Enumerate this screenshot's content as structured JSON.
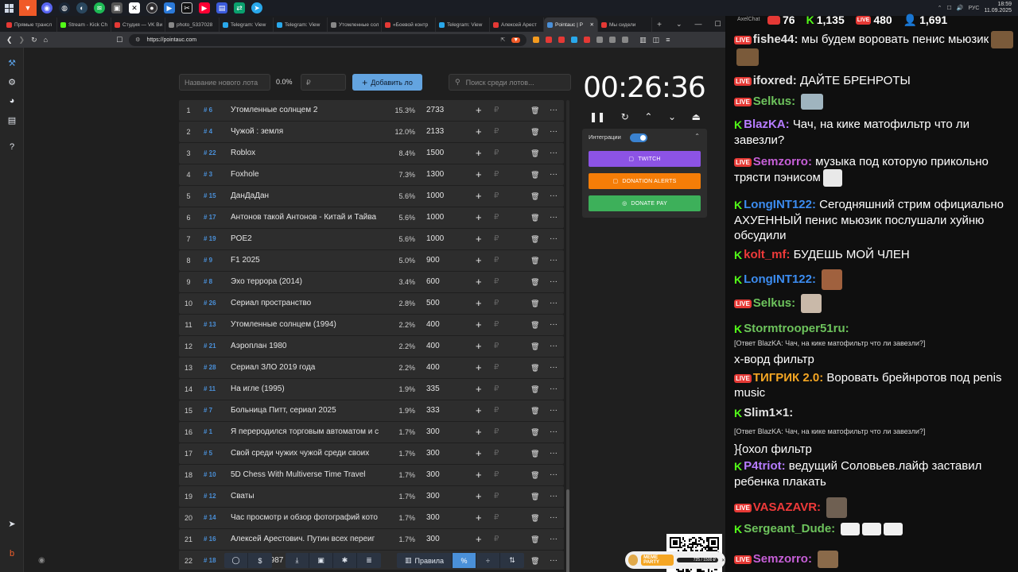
{
  "taskbar": {
    "tray_lang": "РУС",
    "time": "18:59",
    "date": "11.09.2025"
  },
  "browser": {
    "tabs": [
      {
        "label": "Прямые трансл",
        "color": "#e53935"
      },
      {
        "label": "Stream - Kick Ch",
        "color": "#53fc18"
      },
      {
        "label": "Студия — VK Ви",
        "color": "#e53935"
      },
      {
        "label": "photo_5337028",
        "color": "#888888"
      },
      {
        "label": "Telegram: View",
        "color": "#29a8eb"
      },
      {
        "label": "Telegram: View",
        "color": "#29a8eb"
      },
      {
        "label": "Утомленные сол",
        "color": "#888888"
      },
      {
        "label": "«Боевой контр",
        "color": "#e53935"
      },
      {
        "label": "Telegram: View",
        "color": "#29a8eb"
      },
      {
        "label": "Алексей Арест",
        "color": "#e53935"
      },
      {
        "label": "Pointauc | Р",
        "color": "#4a90d9",
        "active": true
      },
      {
        "label": "Мы сидели",
        "color": "#e53935"
      }
    ],
    "new_tab": "+",
    "url": "https://pointauc.com"
  },
  "controls": {
    "lot_name_placeholder": "Название нового лота",
    "percent": "0.0%",
    "price_placeholder": "₽",
    "add_button": "Добавить ло",
    "add_icon": "+",
    "search_placeholder": "Поиск среди лотов..."
  },
  "lots": [
    {
      "rank": "1",
      "id": "# 6",
      "name": "Утомленные солнцем 2",
      "pct": "15.3%",
      "amount": "2733"
    },
    {
      "rank": "2",
      "id": "# 4",
      "name": "Чужой : земля",
      "pct": "12.0%",
      "amount": "2133"
    },
    {
      "rank": "3",
      "id": "# 22",
      "name": "Roblox",
      "pct": "8.4%",
      "amount": "1500"
    },
    {
      "rank": "4",
      "id": "# 3",
      "name": "Foxhole",
      "pct": "7.3%",
      "amount": "1300"
    },
    {
      "rank": "5",
      "id": "# 15",
      "name": "ДанДаДан",
      "pct": "5.6%",
      "amount": "1000"
    },
    {
      "rank": "6",
      "id": "# 17",
      "name": "Антонов такой Антонов - Китай и Тайва",
      "pct": "5.6%",
      "amount": "1000"
    },
    {
      "rank": "7",
      "id": "# 19",
      "name": "POE2",
      "pct": "5.6%",
      "amount": "1000"
    },
    {
      "rank": "8",
      "id": "# 9",
      "name": "F1 2025",
      "pct": "5.0%",
      "amount": "900"
    },
    {
      "rank": "9",
      "id": "# 8",
      "name": "Эхо террора (2014)",
      "pct": "3.4%",
      "amount": "600"
    },
    {
      "rank": "10",
      "id": "# 26",
      "name": "Сериал пространство",
      "pct": "2.8%",
      "amount": "500"
    },
    {
      "rank": "11",
      "id": "# 13",
      "name": "Утомленные солнцем (1994)",
      "pct": "2.2%",
      "amount": "400"
    },
    {
      "rank": "12",
      "id": "# 21",
      "name": "Аэроплан 1980",
      "pct": "2.2%",
      "amount": "400"
    },
    {
      "rank": "13",
      "id": "# 28",
      "name": "Сериал ЗЛО 2019 года",
      "pct": "2.2%",
      "amount": "400"
    },
    {
      "rank": "14",
      "id": "# 11",
      "name": "На игле (1995)",
      "pct": "1.9%",
      "amount": "335"
    },
    {
      "rank": "15",
      "id": "# 7",
      "name": "Больница Питт, сериал 2025",
      "pct": "1.9%",
      "amount": "333"
    },
    {
      "rank": "16",
      "id": "# 1",
      "name": "Я переродился торговым автоматом и с",
      "pct": "1.7%",
      "amount": "300"
    },
    {
      "rank": "17",
      "id": "# 5",
      "name": "Свой среди чужих чужой среди своих",
      "pct": "1.7%",
      "amount": "300"
    },
    {
      "rank": "18",
      "id": "# 10",
      "name": "5D Chess With Multiverse Time Travel",
      "pct": "1.7%",
      "amount": "300"
    },
    {
      "rank": "19",
      "id": "# 12",
      "name": "Сваты",
      "pct": "1.7%",
      "amount": "300"
    },
    {
      "rank": "20",
      "id": "# 14",
      "name": "Час просмотр и обзор фотографий кото",
      "pct": "1.7%",
      "amount": "300"
    },
    {
      "rank": "21",
      "id": "# 16",
      "name": "Алексей Арестович. Путин всех переиг",
      "pct": "1.7%",
      "amount": "300"
    },
    {
      "rank": "22",
      "id": "# 18",
      "name": "Варвары 1987",
      "pct": "1.7%",
      "amount": "300"
    }
  ],
  "row_icons": {
    "plus": "+",
    "rub": "₽",
    "trash": "🗑",
    "more": "···"
  },
  "timer": {
    "value": "00:26:36",
    "controls": [
      "❚❚",
      "↻",
      "⌃",
      "⌄",
      "⏏"
    ]
  },
  "integrations": {
    "title": "Интеграции",
    "enabled": true,
    "buttons": [
      {
        "label": "TWITCH",
        "color": "#8c53e5"
      },
      {
        "label": "DONATION ALERTS",
        "color": "#f57d07"
      },
      {
        "label": "DONATE PAY",
        "color": "#3db05a"
      }
    ]
  },
  "bottom": {
    "rules_label": "Правила",
    "icons": [
      "github-icon",
      "dollar-icon",
      "download-icon",
      "save-icon",
      "bug-icon",
      "list-icon",
      "rules-icon",
      "percent-icon",
      "split-icon",
      "sort-icon"
    ]
  },
  "meme": {
    "badge": "MEME PARTY",
    "progress": "725 / 1500 ₽",
    "progress_fraction": 0.48
  },
  "chat": {
    "title": "AxelChat",
    "stats": [
      {
        "platform": "yt",
        "value": "76"
      },
      {
        "platform": "kick",
        "value": "1,135"
      },
      {
        "platform": "vk",
        "value": "480"
      },
      {
        "platform": "people",
        "value": "1,691"
      }
    ],
    "colors": {
      "yt": "#e53935",
      "kick": "#53fc18"
    },
    "messages": [
      {
        "platform": "yt",
        "user": "fishe44:",
        "user_color": "#e3e3e3",
        "text": "мы будем воровать пенис мьюзик"
      },
      {
        "platform": "yt",
        "user": "ifoxred:",
        "user_color": "#e3e3e3",
        "text": "ДАЙТЕ БРЕНРОТЫ"
      },
      {
        "platform": "yt",
        "user": "Selkus:",
        "user_color": "#6dc35c",
        "text": ""
      },
      {
        "platform": "kick",
        "user": "BlazKA:",
        "user_color": "#b67cff",
        "text": "Чач, на кике матофильтр что ли завезли?"
      },
      {
        "platform": "yt",
        "user": "Semzorro:",
        "user_color": "#c65fd7",
        "text": "музыка под которую прикольно трясти пэнисом"
      },
      {
        "platform": "kick",
        "user": "LongINT122:",
        "user_color": "#3c8cf0",
        "text": "Сегодняшний стрим официально АХУЕННЫЙ пенис мьюзик послушали хуйню обсудили"
      },
      {
        "platform": "kick",
        "user": "kolt_mf:",
        "user_color": "#ef3a3a",
        "text": "БУДЕШЬ МОЙ ЧЛЕН"
      },
      {
        "platform": "kick",
        "user": "LongINT122:",
        "user_color": "#3c8cf0",
        "text": ""
      },
      {
        "platform": "yt",
        "user": "Selkus:",
        "user_color": "#6dc35c",
        "text": ""
      },
      {
        "platform": "kick",
        "user": "Stormtrooper51ru:",
        "user_color": "#6dc35c",
        "text": ""
      },
      {
        "platform": "reply",
        "text": "[Ответ BlazKA: Чач, на кике матофильтр что ли завезли?]"
      },
      {
        "platform": "none",
        "text": "х-ворд фильтр"
      },
      {
        "platform": "yt",
        "user": "ТИГРИК 2.0:",
        "user_color": "#f5a623",
        "text": "Воровать брейнротов под penis music"
      },
      {
        "platform": "kick",
        "user": "Slim1×1:",
        "user_color": "#e3e3e3",
        "text": ""
      },
      {
        "platform": "reply",
        "text": "[Ответ BlazKA: Чач, на кике матофильтр что ли завезли?]"
      },
      {
        "platform": "none",
        "text": "}{охол фильтр"
      },
      {
        "platform": "kick",
        "user": "P4triot:",
        "user_color": "#b67cff",
        "text": "ведущий Соловьев.лайф заставил ребенка плакать"
      },
      {
        "platform": "yt",
        "user": "VASAZAVR:",
        "user_color": "#ef3a3a",
        "text": ""
      },
      {
        "platform": "kick",
        "user": "Sergeant_Dude:",
        "user_color": "#6dc35c",
        "text": ""
      },
      {
        "platform": "yt",
        "user": "Semzorro:",
        "user_color": "#c65fd7",
        "text": ""
      }
    ]
  }
}
